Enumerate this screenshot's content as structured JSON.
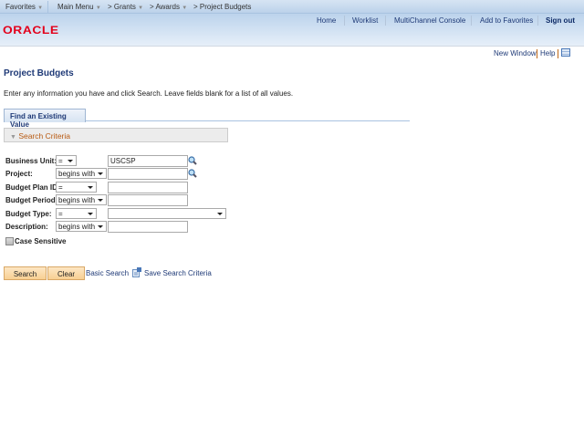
{
  "nav": {
    "favorites": "Favorites",
    "main_menu": "Main Menu",
    "crumbs": [
      "Grants",
      "Awards",
      "Project Budgets"
    ]
  },
  "header": {
    "logo": "ORACLE",
    "links": [
      "Home",
      "Worklist",
      "MultiChannel Console",
      "Add to Favorites"
    ],
    "signout": "Sign out"
  },
  "toolbar": {
    "new_window": "New Window",
    "help": "Help"
  },
  "page": {
    "title": "Project Budgets",
    "instructions": "Enter any information you have and click Search. Leave fields blank for a list of all values.",
    "tab": "Find an Existing Value",
    "section": "Search Criteria"
  },
  "fields": [
    {
      "label": "Business Unit:",
      "operator": "=",
      "value": "USCSP"
    },
    {
      "label": "Project:",
      "operator": "begins with",
      "value": ""
    },
    {
      "label": "Budget Plan ID:",
      "operator": "=",
      "value": ""
    },
    {
      "label": "Budget Period:",
      "operator": "begins with",
      "value": ""
    },
    {
      "label": "Budget Type:",
      "operator": "=",
      "value": ""
    },
    {
      "label": "Description:",
      "operator": "begins with",
      "value": ""
    }
  ],
  "case_sensitive": {
    "label": "Case Sensitive",
    "checked": false
  },
  "actions": {
    "search": "Search",
    "clear": "Clear",
    "basic_search": "Basic Search",
    "save_criteria": "Save Search Criteria"
  }
}
